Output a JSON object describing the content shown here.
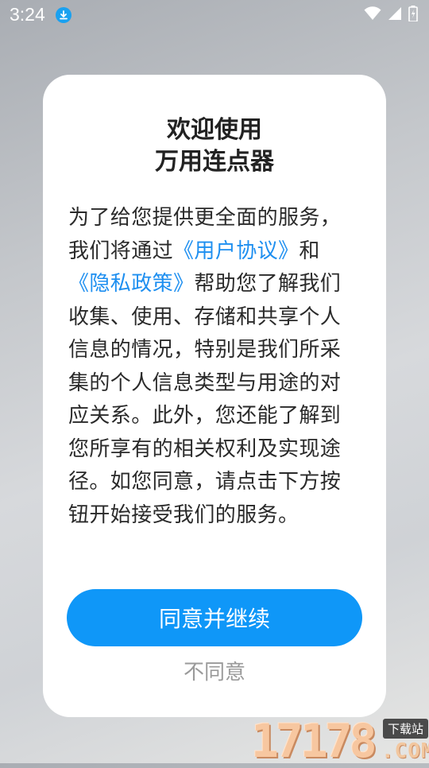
{
  "status_bar": {
    "time": "3:24",
    "icons": [
      "download-icon",
      "wifi-icon",
      "signal-icon",
      "battery-icon"
    ],
    "accent": "#1aa1f0"
  },
  "dialog": {
    "title_line1": "欢迎使用",
    "title_line2": "万用连点器",
    "text_part1": "为了给您提供更全面的服务，我们将通过",
    "link_user_agreement": "《用户协议》",
    "text_and": "和",
    "link_privacy_policy": "《隐私政策》",
    "text_part2": "帮助您了解我们收集、使用、存储和共享个人信息的情况，特别是我们所采集的个人信息类型与用途的对应关系。此外，您还能了解到您所享有的相关权利及实现途径。如您同意，请点击下方按钮开始接受我们的服务。",
    "agree_button": "同意并继续",
    "disagree_button": "不同意",
    "colors": {
      "primary": "#0f97f8",
      "link": "#1e8ff0"
    }
  },
  "watermark": {
    "number": "17178",
    "tag": "下载站",
    "suffix": ".COM"
  }
}
